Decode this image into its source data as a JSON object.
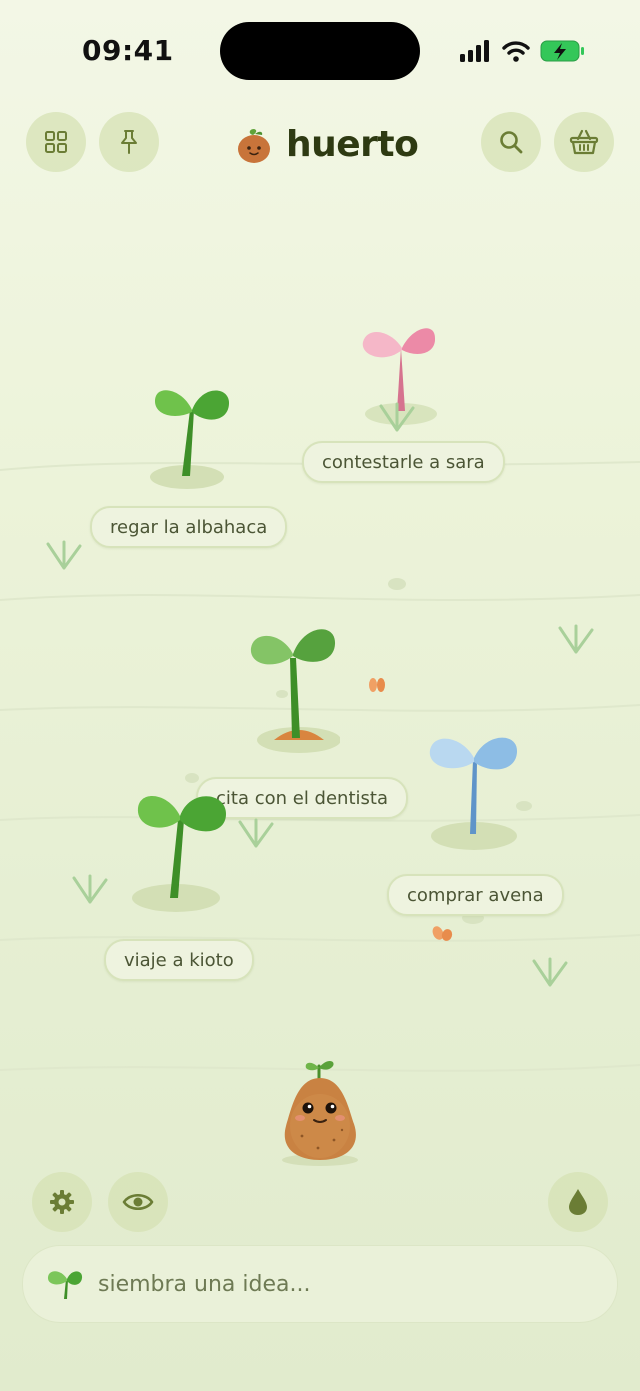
{
  "status_bar": {
    "time": "09:41"
  },
  "header": {
    "app_name": "huerto"
  },
  "plants": [
    {
      "label": "contestarle a sara",
      "color": "pink"
    },
    {
      "label": "regar la albahaca",
      "color": "green"
    },
    {
      "label": "cita con el dentista",
      "color": "green"
    },
    {
      "label": "comprar avena",
      "color": "blue"
    },
    {
      "label": "viaje a kioto",
      "color": "green"
    }
  ],
  "icons": {
    "grid": "grid-icon",
    "pin": "pin-icon",
    "search": "search-icon",
    "basket": "basket-icon",
    "settings": "gear-icon",
    "eye": "eye-icon",
    "water": "water-drop-icon",
    "sprout": "sprout-icon"
  },
  "input": {
    "placeholder": "siembra una idea..."
  },
  "colors": {
    "accent": "#6b7d35",
    "brand_text": "#2e3a12",
    "background": "#ecf3d9"
  }
}
